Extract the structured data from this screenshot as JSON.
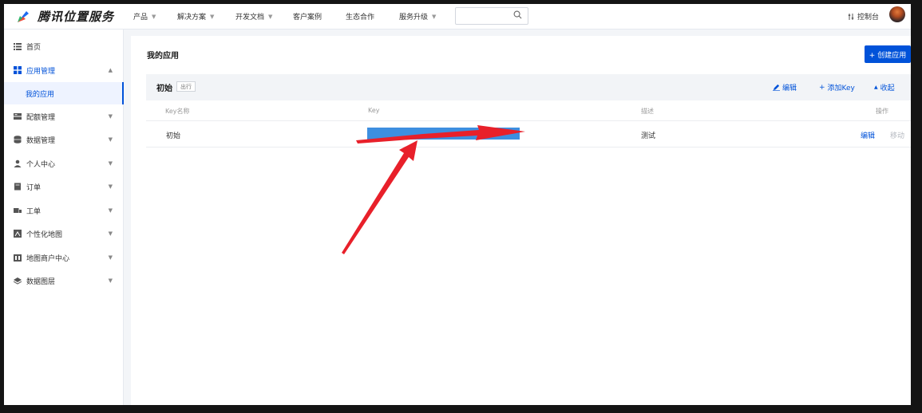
{
  "header": {
    "brand": "腾讯位置服务",
    "nav": [
      {
        "label": "产品",
        "caret": true
      },
      {
        "label": "解决方案",
        "caret": true
      },
      {
        "label": "开发文档",
        "caret": true
      },
      {
        "label": "客户案例",
        "caret": false
      },
      {
        "label": "生态合作",
        "caret": false
      },
      {
        "label": "服务升级",
        "caret": true
      }
    ],
    "search_placeholder": "",
    "console_label": "控制台"
  },
  "sidebar": {
    "items": [
      {
        "label": "首页",
        "icon": "list-icon"
      },
      {
        "label": "应用管理",
        "icon": "grid-icon",
        "expanded": true
      },
      {
        "label": "配额管理",
        "icon": "quota-icon"
      },
      {
        "label": "数据管理",
        "icon": "database-icon"
      },
      {
        "label": "个人中心",
        "icon": "user-icon"
      },
      {
        "label": "订单",
        "icon": "order-icon"
      },
      {
        "label": "工单",
        "icon": "ticket-icon"
      },
      {
        "label": "个性化地图",
        "icon": "map-style-icon"
      },
      {
        "label": "地图商户中心",
        "icon": "merchant-icon"
      },
      {
        "label": "数据图层",
        "icon": "layers-icon"
      }
    ],
    "submenu_active": "我的应用"
  },
  "main": {
    "title": "我的应用",
    "create_button": "+ 创建应用",
    "app": {
      "name": "初始",
      "badge": "出行",
      "actions": {
        "edit": "编辑",
        "add_key": "添加Key",
        "collapse": "收起"
      }
    },
    "table": {
      "columns": [
        "Key名称",
        "Key",
        "描述",
        "操作"
      ],
      "rows": [
        {
          "name": "初始",
          "key_visible": "",
          "desc": "测试",
          "action_edit": "编辑",
          "action_move": "移动"
        }
      ]
    }
  },
  "colors": {
    "accent": "#0052d9",
    "highlight": "#3d8fe0",
    "arrow": "#e8202a"
  }
}
